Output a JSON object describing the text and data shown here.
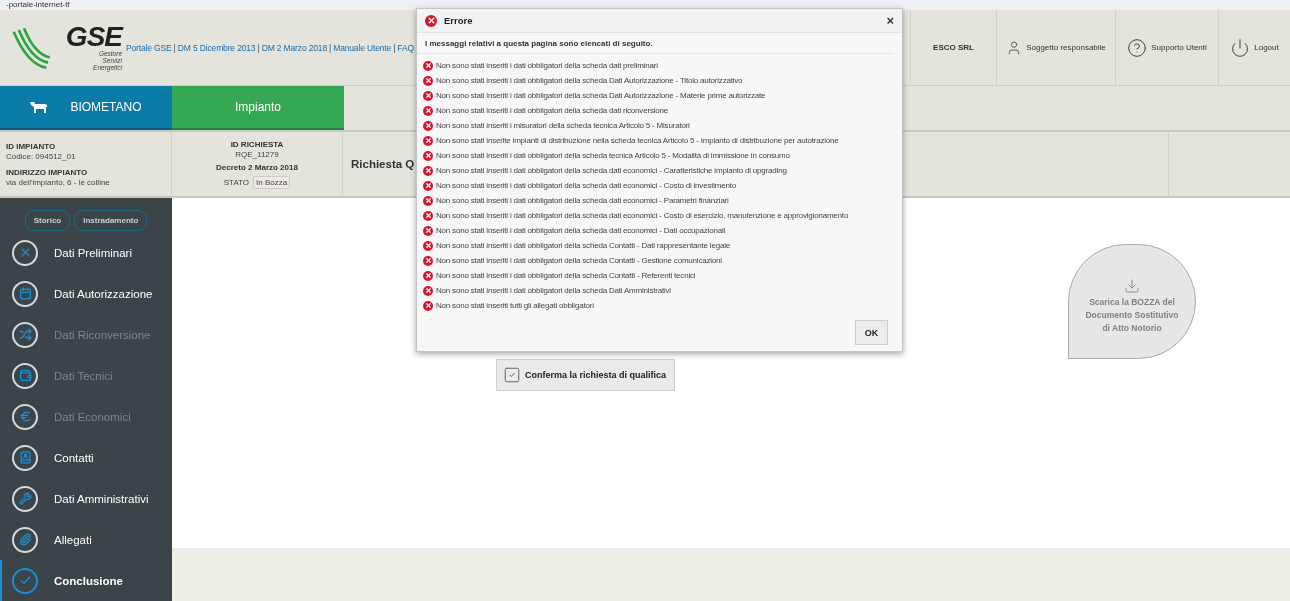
{
  "address_bar": {
    "url": "-portale-internet-tf"
  },
  "logo": {
    "name": "GSE",
    "tagline": [
      "Gestore",
      "Servizi",
      "Energetici"
    ]
  },
  "header_links": [
    "Portale GSE",
    "DM 5 Dicembre 2013",
    "DM 2 Marzo 2018",
    "Manuale Utente",
    "FAQ"
  ],
  "header_link_separator": "|",
  "header_right": [
    {
      "kind": "company",
      "label": "ESCO SRL"
    },
    {
      "kind": "user",
      "label": "Soggetto responsabile"
    },
    {
      "kind": "help",
      "label": "Supporto Utenti"
    },
    {
      "kind": "logout",
      "label": "Logout"
    }
  ],
  "nav_tabs": [
    {
      "label": "BIOMETANO",
      "color": "#0b7ca8"
    },
    {
      "label": "Impianto",
      "color": "#35a853"
    }
  ],
  "info": {
    "plant": {
      "id_title": "ID IMPIANTO",
      "code": "Codice: 094512_01",
      "address_title": "INDIRIZZO IMPIANTO",
      "address": "via dell'impianto, 6 - le colline"
    },
    "request": {
      "id_title": "ID RICHIESTA",
      "id": "RQE_11279",
      "decree": "Decreto 2 Marzo 2018",
      "state_label": "STATO",
      "state": "In Bozza"
    },
    "title": "Richiesta Q"
  },
  "sidebar": {
    "buttons": [
      "Storico",
      "Instradamento"
    ],
    "items": [
      {
        "label": "Dati Preliminari",
        "disabled": false,
        "selected": false
      },
      {
        "label": "Dati Autorizzazione",
        "disabled": false,
        "selected": false
      },
      {
        "label": "Dati Riconversione",
        "disabled": true,
        "selected": false
      },
      {
        "label": "Dati Tecnici",
        "disabled": true,
        "selected": false
      },
      {
        "label": "Dati Economici",
        "disabled": true,
        "selected": false
      },
      {
        "label": "Contatti",
        "disabled": false,
        "selected": false
      },
      {
        "label": "Dati Amministrativi",
        "disabled": false,
        "selected": false
      },
      {
        "label": "Allegati",
        "disabled": false,
        "selected": false
      },
      {
        "label": "Conclusione",
        "disabled": false,
        "selected": true
      }
    ]
  },
  "main": {
    "confirm_button": "Conferma la richiesta di qualifica",
    "download_button": "Scarica la BOZZA del Documento Sostitutivo di Atto Notorio"
  },
  "dialog": {
    "title": "Errore",
    "intro": "I messaggi relativi a questa pagina sono elencati di seguito.",
    "messages": [
      "Non sono stati inseriti i dati obbligatori della scheda dati preliminari",
      "Non sono stati inseriti i dati obbligatori della scheda Dati Autorizzazione - Titolo autorizzativo",
      "Non sono stati inseriti i dati obbligatori della scheda Dati Autorizzazione - Materie prime autorizzate",
      "Non sono stati inseriti i dati obbligatori della scheda dati riconversione",
      "Non sono stati inseriti i misuratori della scheda tecnica Articolo 5 - Misuratori",
      "Non sono stati inserite impianti di distribuzione nella scheda tecnica Articolo 5 - Impianto di distribuzione per autotrazione",
      "Non sono stati inseriti i dati obbligatori della scheda tecnica Articolo 5 - Modalità di immissione in consumo",
      "Non sono stati inseriti i dati obbligatori della scheda dati economici - Caratteristiche impianto di upgrading",
      "Non sono stati inseriti i dati obbligatori della scheda dati economici - Costo di investimento",
      "Non sono stati inseriti i dati obbligatori della scheda dati economici - Parametri finanziari",
      "Non sono stati inseriti i dati obbligatori della scheda dati economici - Costo di esercizio, manutenzione e approvigionamento",
      "Non sono stati inseriti i dati obbligatori della scheda dati economici - Dati occupazionali",
      "Non sono stati inseriti i dati obbligatori della scheda Contatti - Dati rappresentante legale",
      "Non sono stati inseriti i dati obbligatori della scheda Contatti - Gestione comunicazioni",
      "Non sono stati inseriti i dati obbligatori della scheda Contatti - Referenti tecnici",
      "Non sono stati inseriti i dati obbligatori della scheda Dati Amministrativi",
      "Non sono stati inseriti tutti gli allegati obbligatori"
    ],
    "close": "×",
    "ok": "OK"
  }
}
